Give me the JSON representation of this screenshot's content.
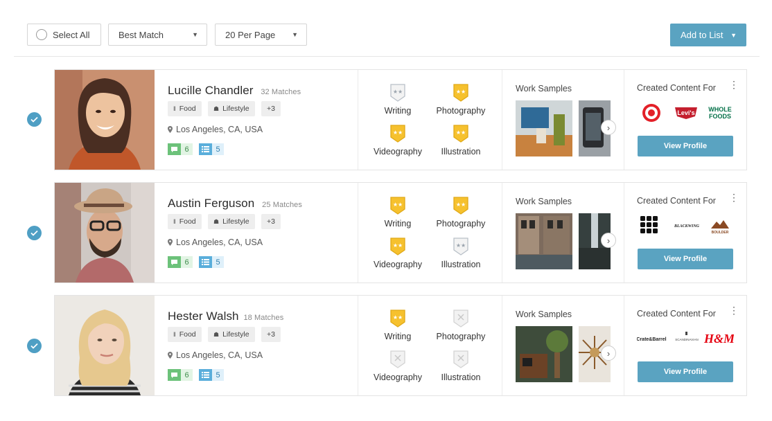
{
  "toolbar": {
    "select_all": "Select All",
    "sort": "Best Match",
    "per_page": "20 Per Page",
    "add_to_list": "Add to List"
  },
  "profiles": [
    {
      "name": "Lucille Chandler",
      "matches": "32 Matches",
      "tags": [
        "Food",
        "Lifestyle",
        "+3"
      ],
      "location": "Los Angeles, CA, USA",
      "messages": "6",
      "lists": "5",
      "skills": [
        {
          "label": "Writing",
          "status": "partial"
        },
        {
          "label": "Photography",
          "status": "active"
        },
        {
          "label": "Videography",
          "status": "active"
        },
        {
          "label": "Illustration",
          "status": "active"
        }
      ],
      "work_samples_label": "Work Samples",
      "created_content_label": "Created Content For",
      "brands": [
        "Target",
        "Levi's",
        "Whole Foods"
      ],
      "view_profile": "View Profile"
    },
    {
      "name": "Austin Ferguson",
      "matches": "25 Matches",
      "tags": [
        "Food",
        "Lifestyle",
        "+3"
      ],
      "location": "Los Angeles, CA, USA",
      "messages": "6",
      "lists": "5",
      "skills": [
        {
          "label": "Writing",
          "status": "active"
        },
        {
          "label": "Photography",
          "status": "active"
        },
        {
          "label": "Videography",
          "status": "active"
        },
        {
          "label": "Illustration",
          "status": "partial"
        }
      ],
      "work_samples_label": "Work Samples",
      "created_content_label": "Created Content For",
      "brands": [
        "M",
        "BLACKWING",
        "BOULDER"
      ],
      "view_profile": "View Profile"
    },
    {
      "name": "Hester Walsh",
      "matches": "18 Matches",
      "tags": [
        "Food",
        "Lifestyle",
        "+3"
      ],
      "location": "Los Angeles, CA, USA",
      "messages": "6",
      "lists": "5",
      "skills": [
        {
          "label": "Writing",
          "status": "active"
        },
        {
          "label": "Photography",
          "status": "none"
        },
        {
          "label": "Videography",
          "status": "none"
        },
        {
          "label": "Illustration",
          "status": "none"
        }
      ],
      "work_samples_label": "Work Samples",
      "created_content_label": "Created Content For",
      "brands": [
        "Crate&Barrel",
        "SCANDINAVIAN",
        "H&M"
      ],
      "view_profile": "View Profile"
    }
  ],
  "colors": {
    "accent": "#5aa3c1",
    "badge_gold": "#f6c12e",
    "message_green": "#6cc27a",
    "list_blue": "#5aaedb"
  }
}
